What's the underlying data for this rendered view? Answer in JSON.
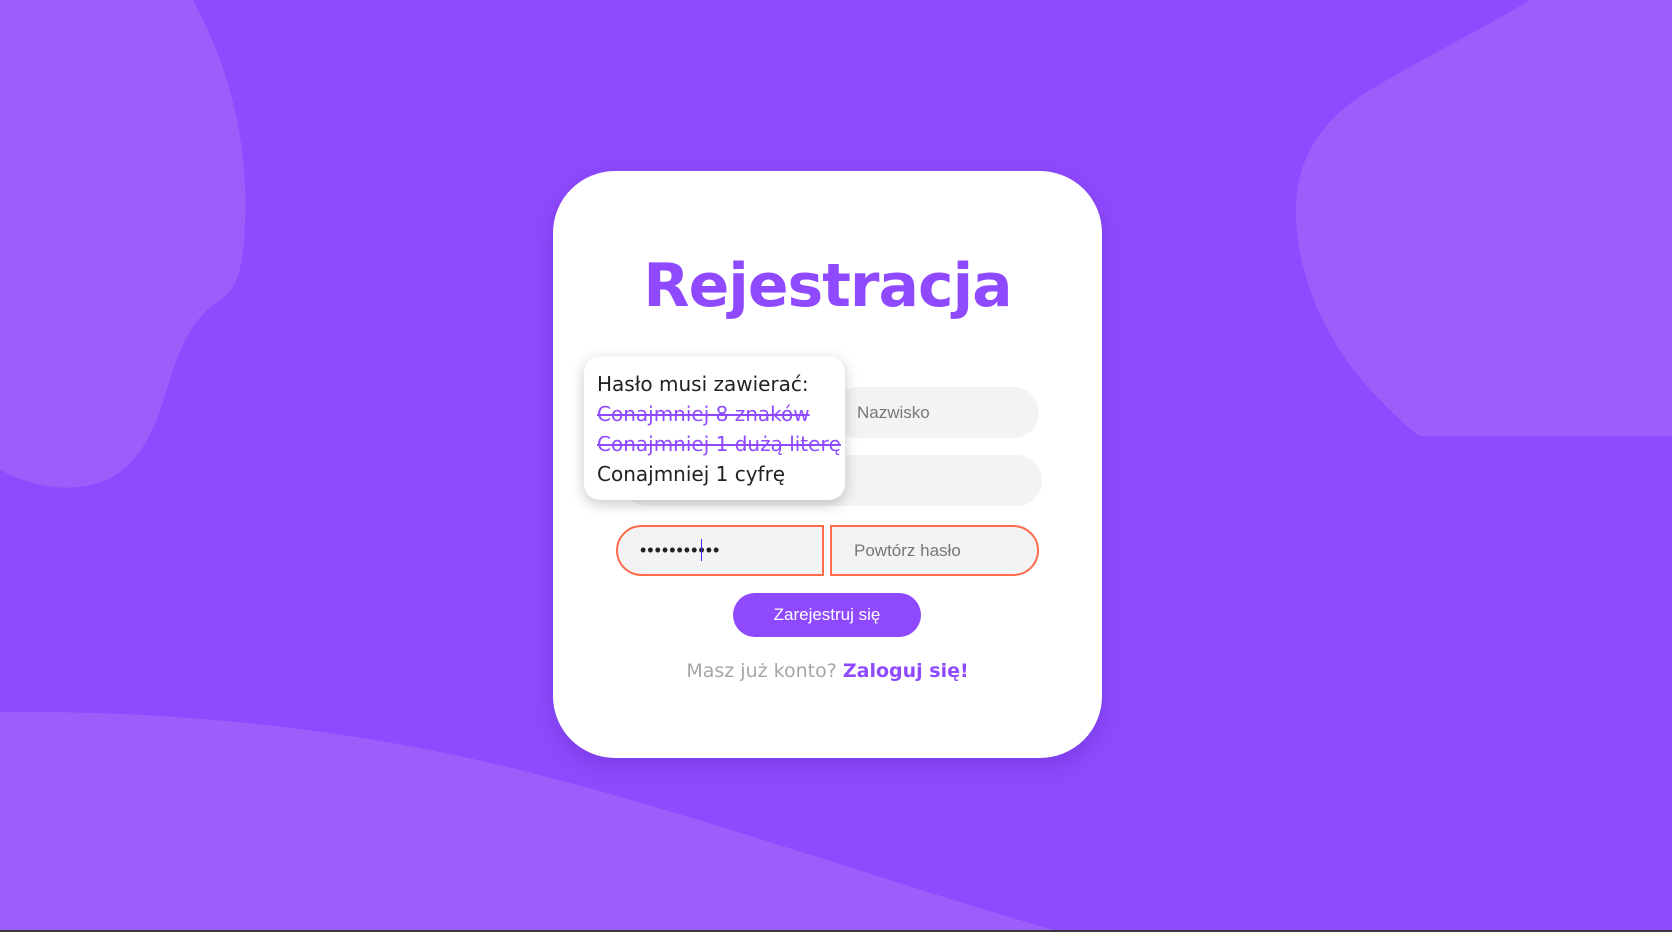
{
  "colors": {
    "background": "#8f4aff",
    "accent": "#8f4aff",
    "error_border": "#ff6b4a",
    "card": "#ffffff"
  },
  "form": {
    "title": "Rejestracja",
    "first_name": {
      "value": "",
      "placeholder": ""
    },
    "last_name": {
      "value": "",
      "placeholder": "Nazwisko"
    },
    "email": {
      "value": "",
      "placeholder": ""
    },
    "password": {
      "value": "•••••••••••",
      "placeholder": ""
    },
    "repeat_password": {
      "value": "",
      "placeholder": "Powtórz hasło"
    },
    "submit_label": "Zarejestruj się",
    "login_prompt": "Masz już konto?",
    "login_link": "Zaloguj się!"
  },
  "password_tooltip": {
    "heading": "Hasło musi zawierać:",
    "rules": [
      {
        "label": "Conajmniej 8 znaków",
        "satisfied": true
      },
      {
        "label": "Conajmniej 1 dużą literę",
        "satisfied": true
      },
      {
        "label": "Conajmniej 1 cyfrę",
        "satisfied": false
      }
    ]
  }
}
